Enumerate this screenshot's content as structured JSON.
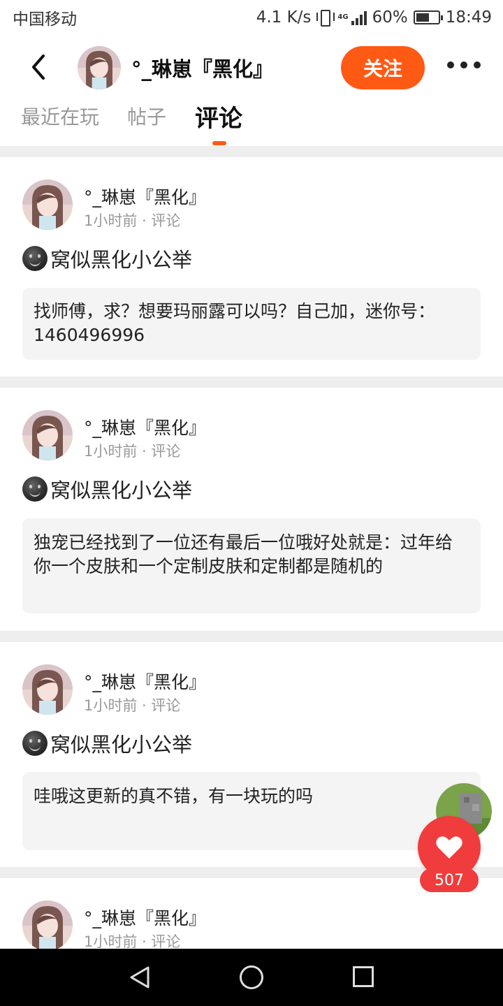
{
  "status_bar": {
    "carrier": "中国移动",
    "speed": "4.1 K/s",
    "network": "4G",
    "battery": "60%",
    "time": "18:49"
  },
  "header": {
    "user_name": "°_琳崽『黑化』",
    "follow_label": "关注"
  },
  "tabs": [
    {
      "label": "最近在玩",
      "active": false
    },
    {
      "label": "帖子",
      "active": false
    },
    {
      "label": "评论",
      "active": true
    }
  ],
  "cards": [
    {
      "user": "°_琳崽『黑化』",
      "time": "1小时前",
      "type": "评论",
      "title": "窝似黑化小公举",
      "comment": "找师傅，求？想要玛丽露可以吗？自己加，迷你号：1460496996"
    },
    {
      "user": "°_琳崽『黑化』",
      "time": "1小时前",
      "type": "评论",
      "title": "窝似黑化小公举",
      "comment": "独宠已经找到了一位还有最后一位哦好处就是：过年给你一个皮肤和一个定制皮肤和定制都是随机的"
    },
    {
      "user": "°_琳崽『黑化』",
      "time": "1小时前",
      "type": "评论",
      "title": "窝似黑化小公举",
      "comment": "哇哦这更新的真不错，有一块玩的吗"
    },
    {
      "user": "°_琳崽『黑化』",
      "time": "1小时前",
      "type": "评论"
    }
  ],
  "like": {
    "count": "507"
  },
  "icons": {
    "back": "chevron-left-icon",
    "more": "more-dots-icon",
    "like": "heart-icon",
    "emoji": "smiley-icon"
  },
  "colors": {
    "accent": "#ff5a14",
    "like": "#f03c3c",
    "comment_bg": "#f4f4f4",
    "divider": "#eeeeee"
  }
}
